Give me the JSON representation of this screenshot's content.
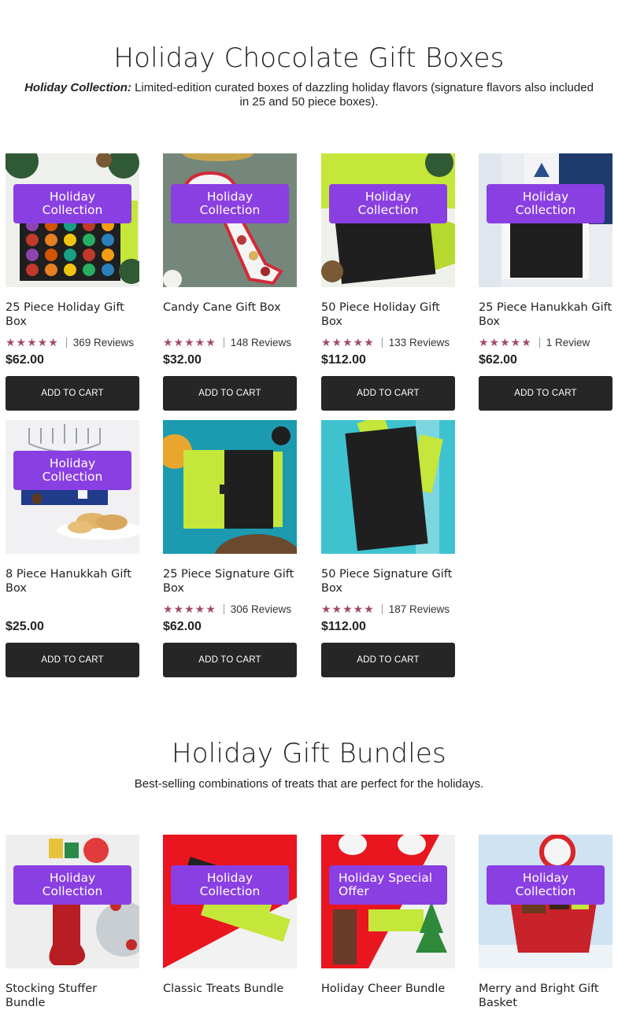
{
  "sections": [
    {
      "title": "Holiday Chocolate Gift Boxes",
      "desc_bold": "Holiday Collection:",
      "desc_text": " Limited-edition curated boxes of dazzling holiday flavors (signature flavors also included in 25 and 50 piece boxes)."
    },
    {
      "title": "Holiday Gift Bundles",
      "desc_text": "Best-selling combinations of treats that are perfect for the holidays."
    }
  ],
  "products": [
    {
      "name": "25 Piece Holiday Gift Box",
      "badge": "Holiday Collection",
      "stars": "★★★★★",
      "reviews": "369 Reviews",
      "price": "$62.00",
      "cta": "ADD TO CART",
      "rating": 5
    },
    {
      "name": "Candy Cane Gift Box",
      "badge": "Holiday Collection",
      "stars": "★★★★★",
      "reviews": "148 Reviews",
      "price": "$32.00",
      "cta": "ADD TO CART",
      "rating": 5
    },
    {
      "name": "50 Piece Holiday Gift Box",
      "badge": "Holiday Collection",
      "stars": "★★★★★",
      "reviews": "133 Reviews",
      "price": "$112.00",
      "cta": "ADD TO CART",
      "rating": 5
    },
    {
      "name": "25 Piece Hanukkah Gift Box",
      "badge": "Holiday Collection",
      "stars": "★★★★★",
      "reviews": "1 Review",
      "price": "$62.00",
      "cta": "ADD TO CART",
      "rating": 5
    },
    {
      "name": "8 Piece Hanukkah Gift Box",
      "badge": "Holiday Collection",
      "price": "$25.00",
      "cta": "ADD TO CART"
    },
    {
      "name": "25 Piece Signature Gift Box",
      "stars": "★★★★★",
      "reviews": "306 Reviews",
      "price": "$62.00",
      "cta": "ADD TO CART",
      "rating": 5
    },
    {
      "name": "50 Piece Signature Gift Box",
      "stars": "★★★★★",
      "reviews": "187 Reviews",
      "price": "$112.00",
      "cta": "ADD TO CART",
      "rating": 5
    }
  ],
  "bundles": [
    {
      "name": "Stocking Stuffer Bundle",
      "badge": "Holiday Collection"
    },
    {
      "name": "Classic Treats Bundle",
      "badge": "Holiday Collection"
    },
    {
      "name": "Holiday Cheer Bundle",
      "badge": "Holiday Special Offer"
    },
    {
      "name": "Merry and Bright Gift Basket",
      "badge": "Holiday Collection"
    }
  ],
  "colors": {
    "badge": "#8a3fe2",
    "button": "#262626",
    "stars": "#a04a6c",
    "box_lime": "#c5e63a"
  },
  "images": {
    "p0": "product-image-25-piece-holiday",
    "p1": "product-image-candy-cane",
    "p2": "product-image-50-piece-holiday",
    "p3": "product-image-25-piece-hanukkah",
    "p4": "product-image-8-piece-hanukkah",
    "p5": "product-image-25-piece-signature",
    "p6": "product-image-50-piece-signature",
    "b0": "bundle-image-stocking",
    "b1": "bundle-image-classic-treats",
    "b2": "bundle-image-holiday-cheer",
    "b3": "bundle-image-merry-bright"
  }
}
